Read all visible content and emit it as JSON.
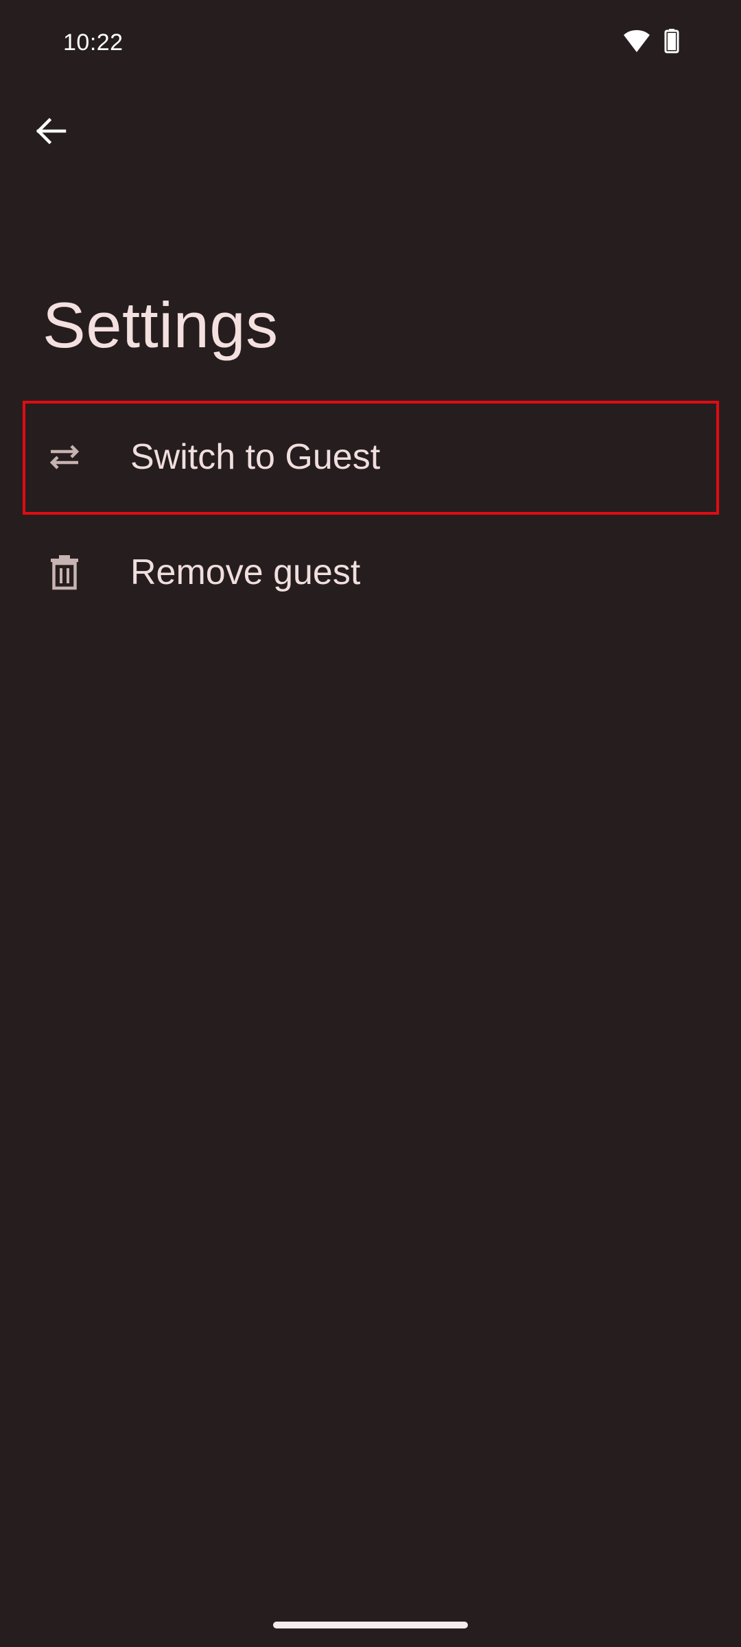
{
  "status_bar": {
    "time": "10:22",
    "icons": [
      "wifi-icon",
      "battery-icon"
    ]
  },
  "toolbar": {
    "back_icon": "arrow-left-icon"
  },
  "page": {
    "title": "Settings"
  },
  "settings_items": [
    {
      "icon": "swap-arrows-icon",
      "label": "Switch to Guest",
      "highlighted": true
    },
    {
      "icon": "trash-icon",
      "label": "Remove guest",
      "highlighted": false
    }
  ],
  "colors": {
    "background": "#261e1e",
    "text": "#f1dede",
    "highlight_border": "#e30b13"
  }
}
